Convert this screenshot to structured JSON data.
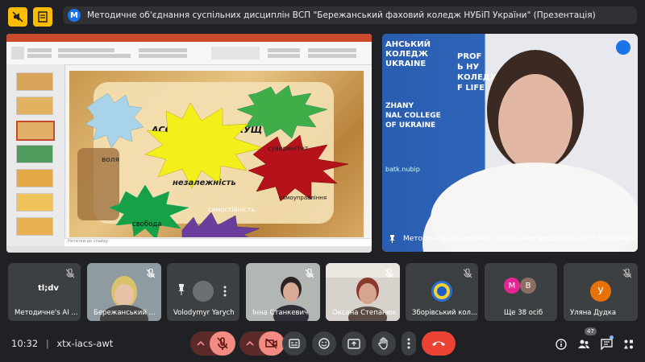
{
  "meeting_title": "Методичне об'єднання суспільних дисциплін ВСП \"Бережанський фаховий коледж НУБіП України\" (Презентація)",
  "meeting_badge": "M",
  "presentation": {
    "slide_title": "АСОЦІАТИВНИЙ КУЩ",
    "bursts": [
      "воля",
      "суверенітет",
      "незалежність",
      "самоуправління",
      "свобода",
      "самостійність"
    ],
    "notes_placeholder": "Нотатки до слайду"
  },
  "speaker": {
    "name_overlay": "Методичне об'єднання суспільних дисциплін ВСП \"Бережанський ...",
    "wall_text_left": "АНСЬКИЙ\nКОЛЕДЖ\nUKRAINE",
    "wall_text_mid": "ZHANY\nNAL COLLEGE\nOF UKRAINE",
    "wall_text_right": "PROF\nЬ НУ\nКОЛЕДЖ\nF LIFE",
    "wall_url": "batk.nubip"
  },
  "participants": [
    {
      "name": "Методичне's AI ...",
      "logo_text": "tl;dv"
    },
    {
      "name": "Бережанський ..."
    },
    {
      "name": "Volodymyr Yarych"
    },
    {
      "name": "Інна Станкевич"
    },
    {
      "name": "Оксана Степанюк"
    },
    {
      "name": "Зборівський кол..."
    },
    {
      "name": "Ще 38 осіб",
      "initials": [
        "M",
        "B"
      ]
    },
    {
      "name": "Уляна Дудка",
      "initial": "У"
    }
  ],
  "bottom_bar": {
    "time": "10:32",
    "separator": "|",
    "meeting_code": "xtx-iacs-awt",
    "people_count": "47"
  },
  "colors": {
    "background": "#202124",
    "tile": "#3c4043",
    "end_call": "#ea4335",
    "accent_yellow": "#fbbc04",
    "blue": "#1a73e8",
    "ulyana_avatar": "#e8710a"
  }
}
